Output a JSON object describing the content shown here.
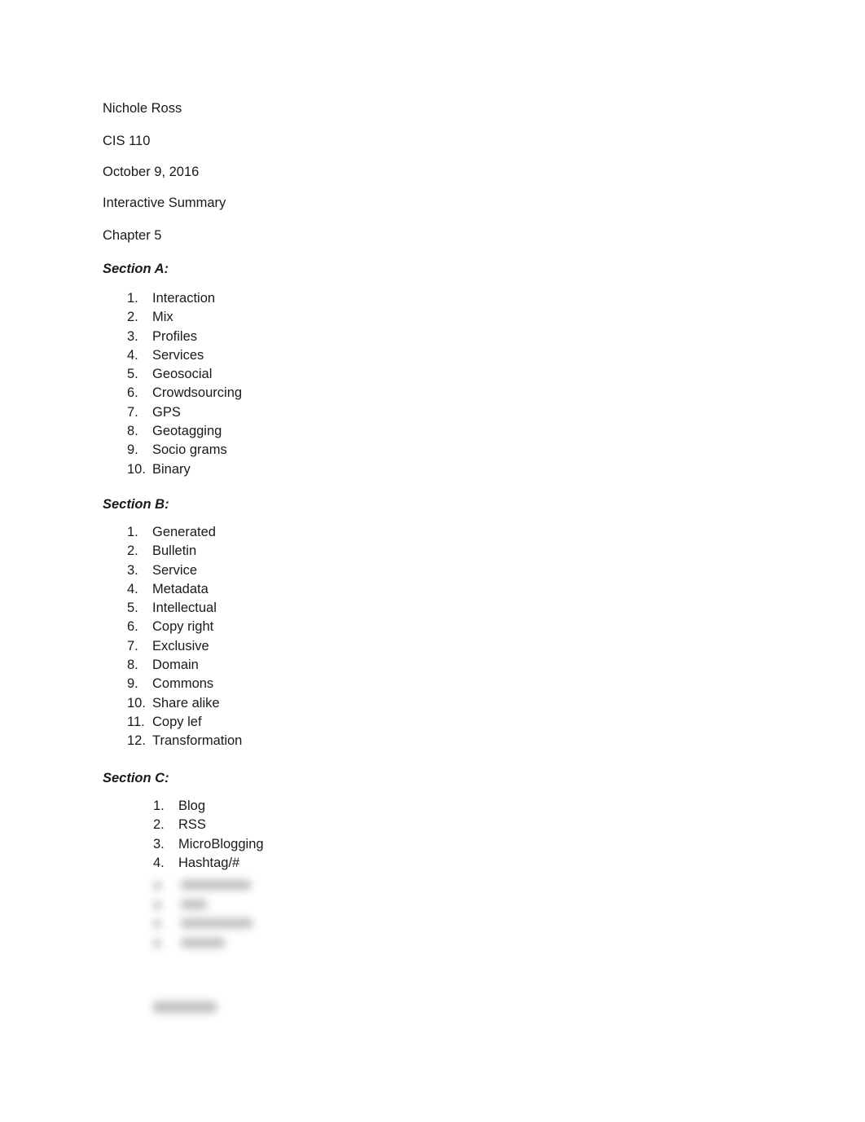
{
  "header": {
    "name": "Nichole Ross",
    "course": "CIS 110",
    "date": "October 9, 2016",
    "assignment": "Interactive Summary",
    "chapter": "Chapter 5"
  },
  "sections": [
    {
      "heading": "Section A:",
      "items": [
        {
          "num": "1.",
          "text": "Interaction"
        },
        {
          "num": "2.",
          "text": "Mix"
        },
        {
          "num": "3.",
          "text": "Profiles"
        },
        {
          "num": "4.",
          "text": "Services"
        },
        {
          "num": "5.",
          "text": "Geosocial"
        },
        {
          "num": "6.",
          "text": "Crowdsourcing"
        },
        {
          "num": "7.",
          "text": "GPS"
        },
        {
          "num": "8.",
          "text": "Geotagging"
        },
        {
          "num": "9.",
          "text": "Socio grams"
        },
        {
          "num": "10.",
          "text": "Binary"
        }
      ]
    },
    {
      "heading": "Section B:",
      "items": [
        {
          "num": "1.",
          "text": "Generated"
        },
        {
          "num": "2.",
          "text": "Bulletin"
        },
        {
          "num": "3.",
          "text": "Service"
        },
        {
          "num": "4.",
          "text": "Metadata"
        },
        {
          "num": "5.",
          "text": "Intellectual"
        },
        {
          "num": "6.",
          "text": "Copy right"
        },
        {
          "num": "7.",
          "text": "Exclusive"
        },
        {
          "num": "8.",
          "text": "Domain"
        },
        {
          "num": "9.",
          "text": "Commons"
        },
        {
          "num": "10.",
          "text": "Share alike"
        },
        {
          "num": "11.",
          "text": "Copy lef"
        },
        {
          "num": "12.",
          "text": "Transformation"
        }
      ]
    },
    {
      "heading": "Section C:",
      "items": [
        {
          "num": "1.",
          "text": "Blog"
        },
        {
          "num": "2.",
          "text": "RSS"
        },
        {
          "num": "3.",
          "text": "MicroBlogging"
        },
        {
          "num": "4.",
          "text": "Hashtag/#"
        }
      ]
    }
  ]
}
